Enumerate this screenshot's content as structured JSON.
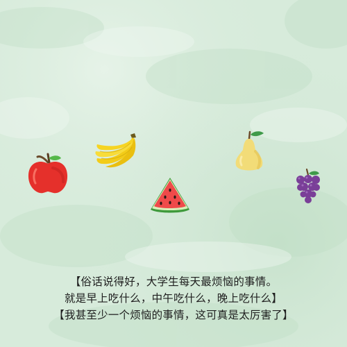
{
  "background": {
    "base_color": "#d9ecdd",
    "texture": "watercolor-paper"
  },
  "fruits": [
    {
      "id": "apple",
      "icon": "apple-icon",
      "color": "#e5302b"
    },
    {
      "id": "banana",
      "icon": "banana-icon",
      "color": "#f6d21e"
    },
    {
      "id": "melon",
      "icon": "watermelon-icon",
      "color": "#ef4a4a"
    },
    {
      "id": "pear",
      "icon": "pear-icon",
      "color": "#f2dc78"
    },
    {
      "id": "grapes",
      "icon": "grapes-icon",
      "color": "#7a3f98"
    }
  ],
  "caption": {
    "line1": "【俗话说得好，大学生每天最烦恼的事情。",
    "line2": "就是早上吃什么，中午吃什么，晚上吃什么】",
    "line3": "【我甚至少一个烦恼的事情，这可真是太厉害了】",
    "color": "#1e1e1e"
  }
}
